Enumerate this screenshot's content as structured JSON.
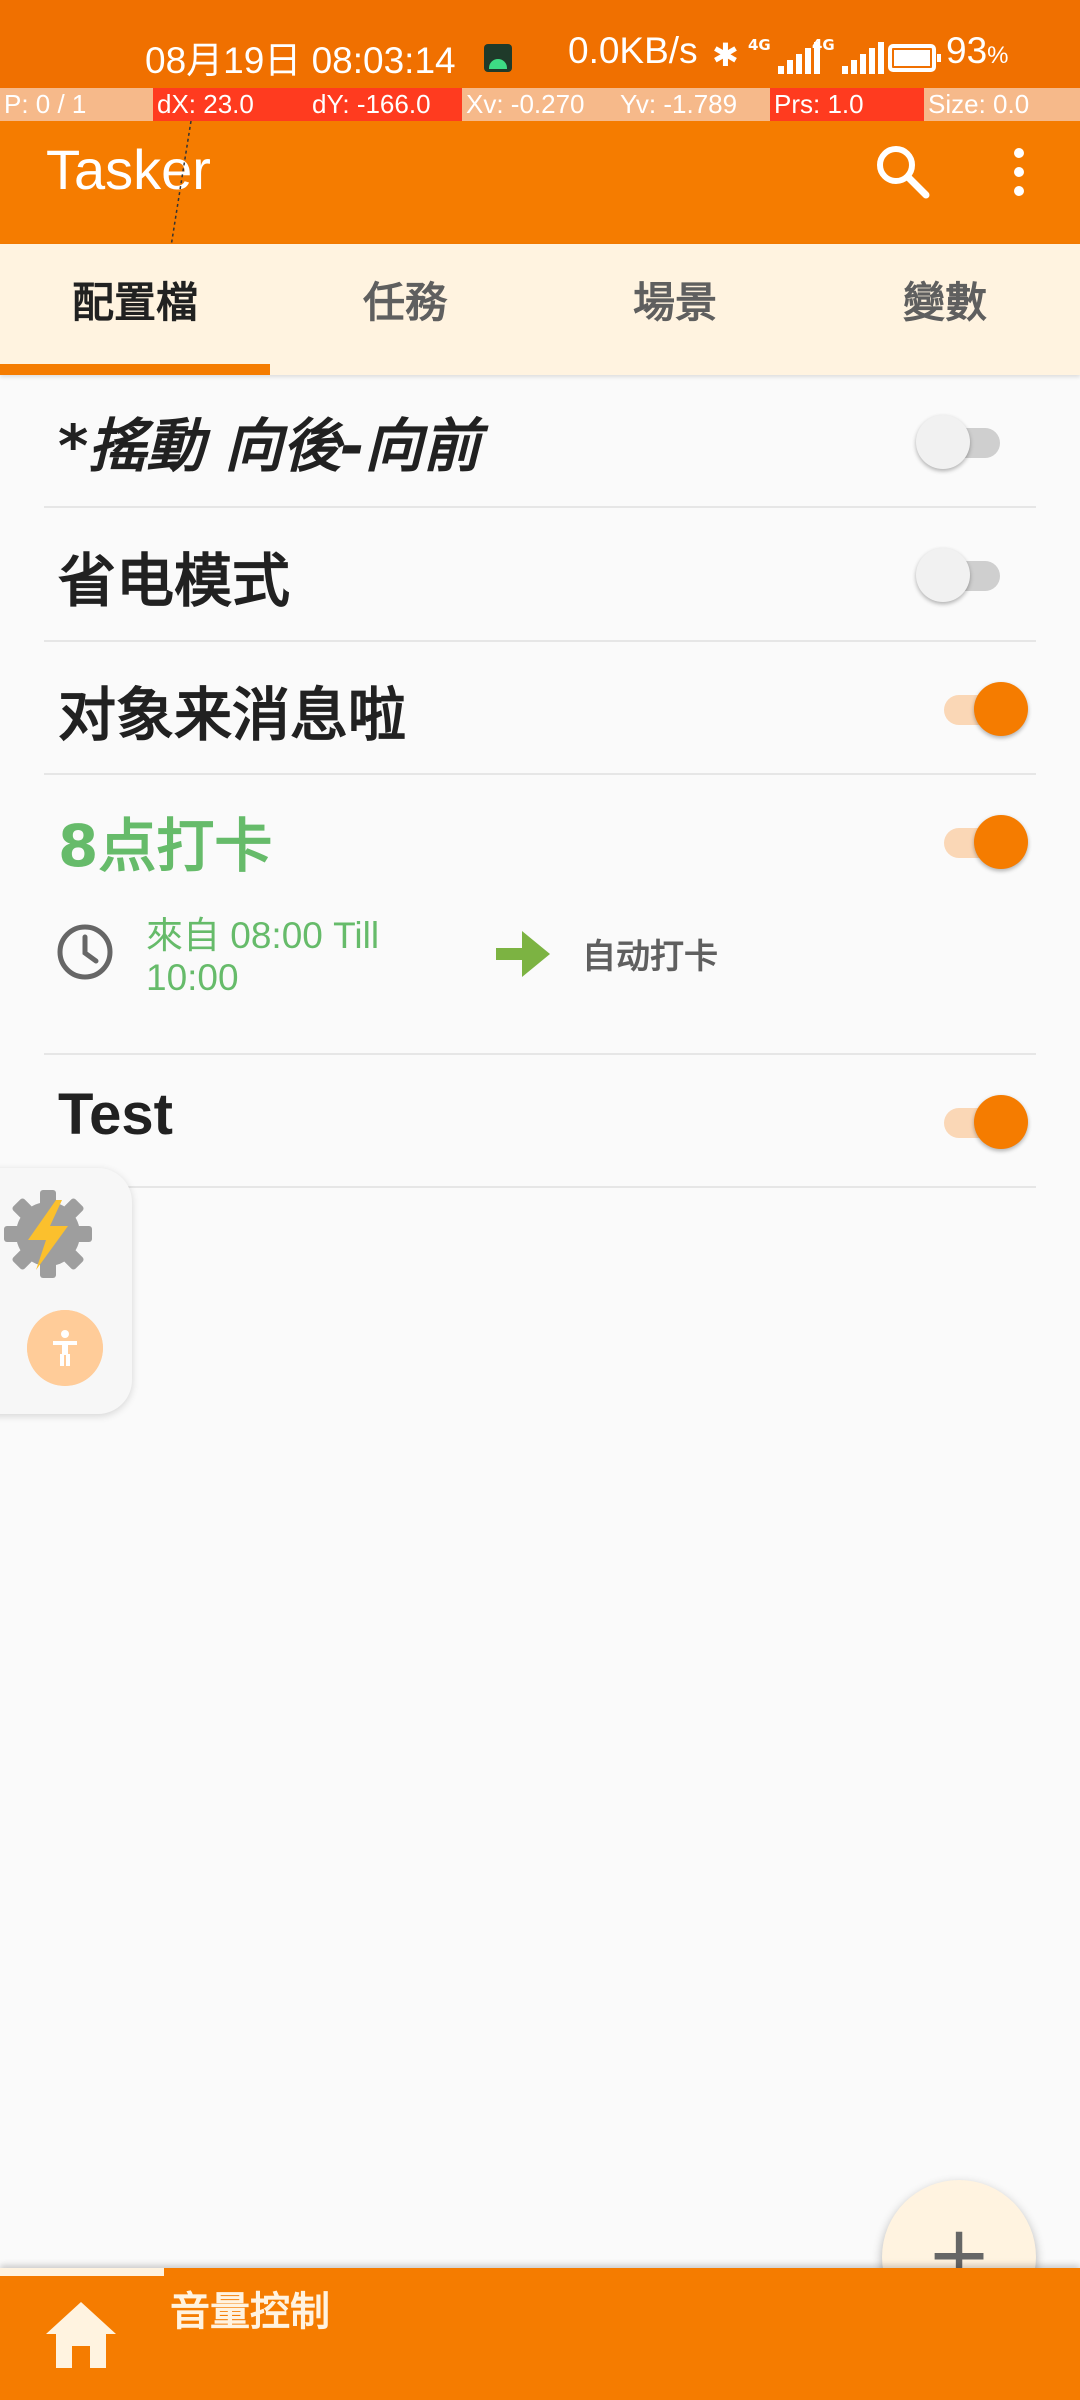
{
  "status_bar": {
    "datetime": "08月19日 08:03:14",
    "net_speed": "0.0KB/s",
    "network_type": "4G",
    "battery_pct": "93",
    "battery_unit": "%"
  },
  "pointer_overlay": {
    "p": "P: 0 / 1",
    "dx": "dX: 23.0",
    "dy": "dY: -166.0",
    "xv": "Xv: -0.270",
    "yv": "Yv: -1.789",
    "prs": "Prs: 1.0",
    "size": "Size: 0.0"
  },
  "app_bar": {
    "title": "Tasker"
  },
  "tabs": [
    {
      "label": "配置檔"
    },
    {
      "label": "任務"
    },
    {
      "label": "場景"
    },
    {
      "label": "變數"
    }
  ],
  "profiles": [
    {
      "name": "*搖動 向後-向前",
      "enabled": false
    },
    {
      "name": "省电模式",
      "enabled": false
    },
    {
      "name": "对象来消息啦",
      "enabled": true
    },
    {
      "name": "8点打卡",
      "enabled": true,
      "context": "來自 08:00 Till 10:00",
      "task": "自动打卡"
    },
    {
      "name": "Test",
      "enabled": true
    }
  ],
  "fab": {
    "label": "+"
  },
  "bottom_bar": {
    "project_label": "音量控制"
  },
  "colors": {
    "primary": "#f57c00",
    "status_bar": "#f07000",
    "tab_background": "#fff3e0",
    "active_text": "#66bb6a",
    "switch_on": "#f57c00"
  },
  "icons": {
    "search": "search-icon",
    "more": "more-vert-icon",
    "clock": "clock-icon",
    "arrow": "arrow-right-icon",
    "home": "home-icon",
    "tasker_gear": "tasker-gear-icon",
    "accessibility": "accessibility-icon"
  }
}
